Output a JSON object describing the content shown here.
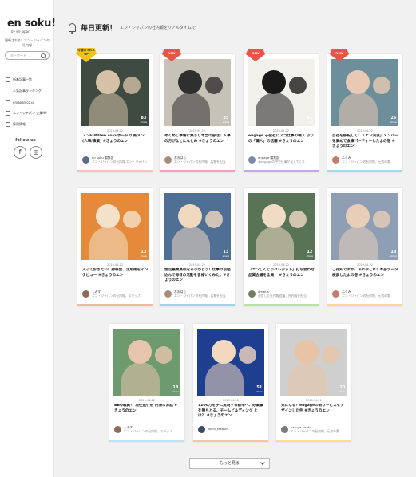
{
  "sidebar": {
    "logo": "en soku!",
    "logo_sub": "by en-japan",
    "tagline": "更新される！エン・ジャパンの社内報",
    "search_placeholder": "キーワード",
    "nav": [
      {
        "label": "新着記事一覧"
      },
      {
        "label": "人気記事ランキング"
      },
      {
        "label": "enjapan.co.jp"
      },
      {
        "label": "エン・ジャパン 企業HP"
      },
      {
        "label": "採用情報"
      }
    ],
    "follow": "follow us !",
    "social": [
      {
        "icon": "facebook-icon",
        "glyph": "f"
      },
      {
        "icon": "instagram-icon",
        "glyph": "◎"
      }
    ]
  },
  "header": {
    "title": "毎日更新！",
    "subtitle": "エン・ジャパンの社内報をリアルタイムで"
  },
  "cards": [
    {
      "badge": "今週の PICK UP",
      "badge_type": "yellow",
      "photo_bg": "#3f4a40",
      "photo_fg": "#d5c1a8",
      "shares": "83",
      "date": "2019.04.22",
      "title": "ノンFUNDen sokuボードの 新メン (人事/事業) #きょうのエン",
      "author_name": "en soku 編集部",
      "author_sub": "エン・ジャパンの社内報 エン・ジャパン",
      "accent": "#f3c2c2",
      "avatar": "#5a6c8a"
    },
    {
      "badge": "new",
      "badge_type": "new",
      "photo_bg": "#c7c2b8",
      "photo_fg": "#2f2f2f",
      "shares": "35",
      "date": "2019.04.22",
      "title": "めくめし準備に集まり本当の部活！人事の方がなとになとみ #きょうのエン",
      "author_name": "おおはら",
      "author_sub": "エン・ジャパンの社内報、広報を担当",
      "accent": "#f2a0c3",
      "avatar": "#a48e7a"
    },
    {
      "badge": "new",
      "badge_type": "new",
      "photo_bg": "#f2f0ea",
      "photo_fg": "#1a1a1a",
      "shares": "61",
      "date": "2019.04.22",
      "title": "engage 子役社にスゴ仕事の職人 ぶりの「職人」の活躍 #きょうのエン",
      "author_name": "engage 編集部",
      "author_sub": "#engageの中で仕事が見えてくる",
      "accent": "#c9a6e4",
      "avatar": "#7c8aa6"
    },
    {
      "badge": "new",
      "badge_type": "new",
      "photo_bg": "#6d8f9b",
      "photo_fg": "#e9c9b3",
      "shares": "26",
      "date": "2019.04.22",
      "title": "自社を移転して！「エン決演」メンバーを集めて食事パーティーしたよの巻 #きょうのエン",
      "author_name": "ふくみ",
      "author_sub": "エン・ジャパンの社内報、元気の素",
      "accent": "#a8d8ec",
      "avatar": "#c77b6a"
    },
    {
      "badge": "",
      "badge_type": "",
      "photo_bg": "#e58a3a",
      "photo_fg": "#f3e2c9",
      "shares": "13",
      "date": "2019.04.22",
      "title": "入っておきたい！持株会、活用術をインタビュー #きょうのエン",
      "author_name": "しみず",
      "author_sub": "エン・ジャパンの社内報、スタッフ",
      "accent": "#f5b7a1",
      "avatar": "#8e6b54"
    },
    {
      "badge": "",
      "badge_type": "",
      "photo_bg": "#4f6f95",
      "photo_fg": "#f0d9bf",
      "shares": "13",
      "date": "2019.04.22",
      "title": "金足農業高校をありがとう！仕事の取組込んで毎日の活動を皆様いくみた。#きょうのエン",
      "author_name": "おおはら",
      "author_sub": "エン・ジャパンの社内報、広報を担当",
      "accent": "#9fd3e8",
      "avatar": "#a48e7a"
    },
    {
      "badge": "",
      "badge_type": "",
      "photo_bg": "#597357",
      "photo_fg": "#f0dcc4",
      "shares": "12",
      "date": "2019.04.22",
      "title": "「エンしくじりクレジット」打ち合わせ品質会議を全員！ #きょうのエン",
      "author_name": "dmakis",
      "author_sub": "運営した社内報会議、社内報を担当",
      "accent": "#b9e1a3",
      "avatar": "#6f7d61"
    },
    {
      "badge": "",
      "badge_type": "",
      "photo_bg": "#8e9fb5",
      "photo_fg": "#e8cdb8",
      "shares": "18",
      "date": "2019.04.22",
      "title": "ご存知ですか、あれやこれ！本部データ検索したよの巻 #きょうのエン",
      "author_name": "ふくみ",
      "author_sub": "エン・ジャパンの社内報、元気の素",
      "accent": "#f6d98c",
      "avatar": "#c77b6a"
    },
    {
      "badge": "",
      "badge_type": "",
      "photo_bg": "#6e9a6f",
      "photo_fg": "#e6c5ac",
      "shares": "18",
      "date": "2019.04.22",
      "title": "BBQ職員！ 現在進行形 円滑なお話 #きょうのエン",
      "author_name": "しみず",
      "author_sub": "エン・ジャパンの社内報、スタッフ",
      "accent": "#bde3f1",
      "avatar": "#8e6b54"
    },
    {
      "badge": "",
      "badge_type": "",
      "photo_bg": "#1e3f8f",
      "photo_fg": "#f3d8bf",
      "shares": "51",
      "date": "2019.04.22",
      "title": "1200万を手に実現する新卒へ、好業績を勝ちとる、チームビルディング とは？ #きょうのエン",
      "author_name": "kochi_takashi",
      "author_sub": "",
      "accent": "#f4c995",
      "avatar": "#3e4c6b"
    },
    {
      "badge": "",
      "badge_type": "",
      "photo_bg": "#cfcfcf",
      "photo_fg": "#e7c4a6",
      "shares": "20",
      "date": "2019.04.22",
      "title": "気になる！engageの新サービスをデザインした件 #きょうのエン",
      "author_name": "kazuya.hirato",
      "author_sub": "エン・ジャパンの社内報、元気の素",
      "accent": "#f6e27e",
      "avatar": "#7a7a7a"
    }
  ],
  "more_button": "もっと見る",
  "colors": {
    "new_badge": "#e8534a",
    "pick_badge": "#f2c219"
  }
}
